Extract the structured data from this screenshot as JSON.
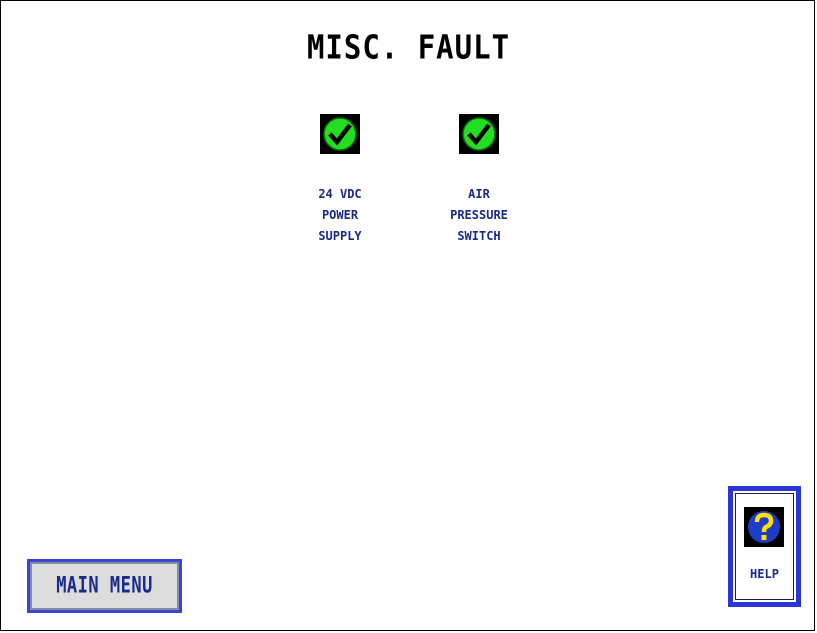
{
  "screen": {
    "title": "MISC. FAULT"
  },
  "indicators": [
    {
      "label": "24 VDC\nPOWER\nSUPPLY",
      "status": "ok",
      "icon": "green-check-icon",
      "color": "#22dd22"
    },
    {
      "label": "AIR\nPRESSURE\nSWITCH",
      "status": "ok",
      "icon": "green-check-icon",
      "color": "#22dd22"
    }
  ],
  "buttons": {
    "main_menu_label": "MAIN MENU",
    "help_label": "HELP",
    "help_icon": "question-mark-icon"
  },
  "colors": {
    "label_text": "#1a2a8c",
    "button_frame": "#2a36d8",
    "help_circle": "#1e3cc8",
    "help_mark": "#ffe000"
  }
}
